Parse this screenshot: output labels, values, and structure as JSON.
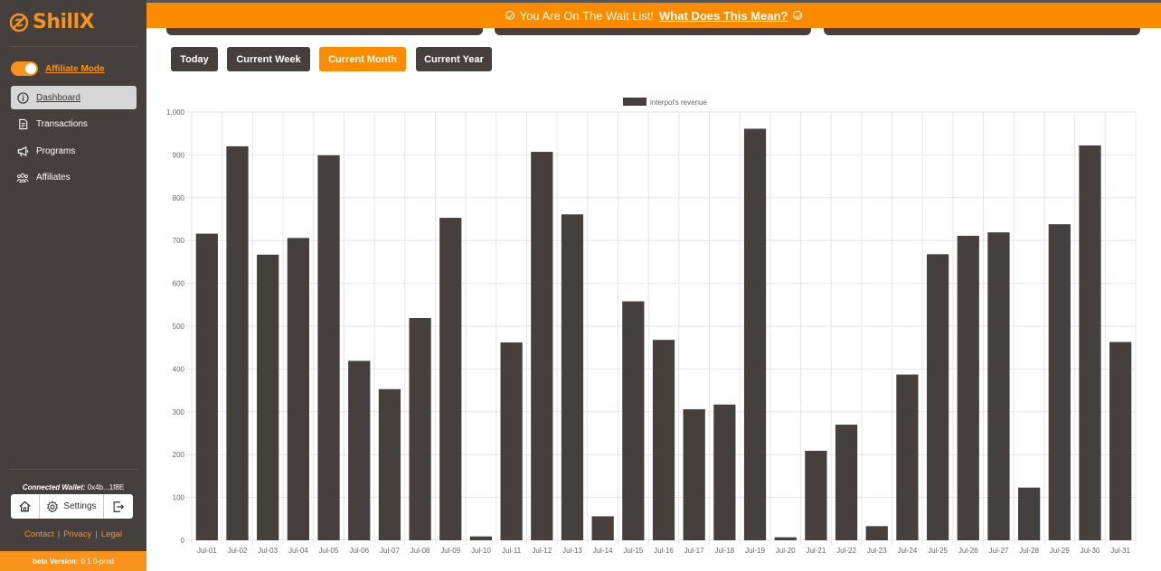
{
  "brand": {
    "name": "ShillX"
  },
  "sidebar": {
    "affiliate_mode_label": "Affiliate Mode",
    "affiliate_mode_on": true,
    "items": [
      {
        "label": "Dashboard",
        "icon": "info-icon",
        "active": true
      },
      {
        "label": "Transactions",
        "icon": "document-icon",
        "active": false
      },
      {
        "label": "Programs",
        "icon": "megaphone-icon",
        "active": false
      },
      {
        "label": "Affiliates",
        "icon": "users-icon",
        "active": false
      }
    ],
    "wallet_label": "Connected Wallet:",
    "wallet_address": "0x4b...1f8E",
    "settings_label": "Settings",
    "links": {
      "contact": "Contact",
      "privacy": "Privacy",
      "legal": "Legal"
    },
    "version_label": "beta Version:",
    "version_value": "0.1.0-prod"
  },
  "banner": {
    "text": "You Are On The Wait List!",
    "link": "What Does This Mean?"
  },
  "tabs": [
    {
      "label": "Today",
      "active": false
    },
    {
      "label": "Current Week",
      "active": false
    },
    {
      "label": "Current Month",
      "active": true
    },
    {
      "label": "Current Year",
      "active": false
    }
  ],
  "colors": {
    "accent": "#fb8c00",
    "brand": "#f7931a",
    "dark": "#45403d",
    "bar": "#45403d",
    "grid": "#e6e6e6"
  },
  "chart_data": {
    "type": "bar",
    "title": "",
    "xlabel": "",
    "ylabel": "",
    "ylim": [
      0,
      1000
    ],
    "y_ticks": [
      "0",
      "100",
      "200",
      "300",
      "400",
      "500",
      "600",
      "700",
      "800",
      "900",
      "1,000"
    ],
    "legend_position": "top-center",
    "grid": true,
    "categories": [
      "Jul-01",
      "Jul-02",
      "Jul-03",
      "Jul-04",
      "Jul-05",
      "Jul-06",
      "Jul-07",
      "Jul-08",
      "Jul-09",
      "Jul-10",
      "Jul-11",
      "Jul-12",
      "Jul-13",
      "Jul-14",
      "Jul-15",
      "Jul-16",
      "Jul-17",
      "Jul-18",
      "Jul-19",
      "Jul-20",
      "Jul-21",
      "Jul-22",
      "Jul-23",
      "Jul-24",
      "Jul-25",
      "Jul-26",
      "Jul-27",
      "Jul-28",
      "Jul-29",
      "Jul-30",
      "Jul-31"
    ],
    "series": [
      {
        "name": "interpol's revenue",
        "values": [
          716,
          920,
          667,
          706,
          899,
          419,
          353,
          519,
          753,
          9,
          462,
          907,
          761,
          56,
          558,
          468,
          306,
          317,
          961,
          7,
          209,
          270,
          33,
          387,
          668,
          711,
          719,
          123,
          738,
          922,
          463
        ]
      }
    ]
  }
}
